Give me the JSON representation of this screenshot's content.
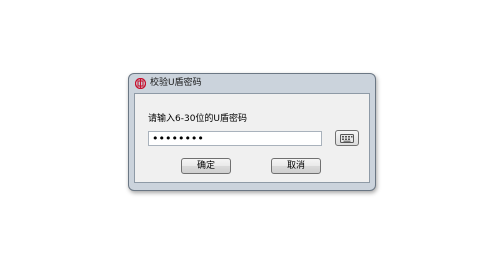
{
  "dialog": {
    "title": "校验U盾密码",
    "logo_icon": "bank-of-china-logo-icon",
    "prompt": "请输入6-30位的U盾密码",
    "password_value": "••••••••",
    "keyboard_icon": "soft-keyboard-icon",
    "ok_label": "确定",
    "cancel_label": "取消",
    "accent_color": "#c8102e"
  }
}
